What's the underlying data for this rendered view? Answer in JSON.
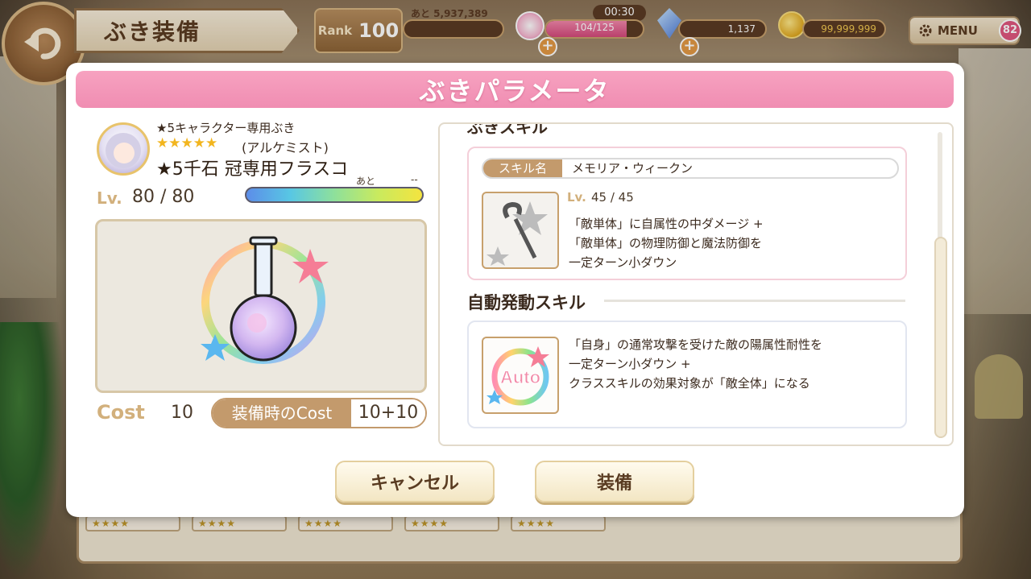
{
  "topbar": {
    "screen_title": "ぶき装備",
    "rank_label": "Rank",
    "rank_value": "100",
    "exp_text": "あと 5,937,389",
    "stamina_timer": "00:30",
    "stamina_text": "104/125",
    "stamina_fraction": 0.832,
    "gems": "1,137",
    "coins": "99,999,999",
    "menu_label": "MENU",
    "menu_badge": "82",
    "plus_symbol": "+"
  },
  "modal": {
    "title": "ぶきパラメータ",
    "weapon": {
      "type": "★5キャラクター専用ぶき",
      "stars": "★★★★★",
      "class": "(アルケミスト)",
      "name": "★5千石 冠専用フラスコ",
      "lv_label": "Lv.",
      "lv_value": "80 / 80",
      "lv_remaining_label": "あと",
      "lv_remaining_value": "--",
      "cost_label": "Cost",
      "cost_value": "10",
      "equip_cost_label": "装備時のCost",
      "equip_cost_value": "10+10"
    },
    "skill": {
      "section_title_cut": "ぶきスキル",
      "name_label": "スキル名",
      "name_value": "メモリア・ウィークン",
      "lv_label": "Lv.",
      "lv_value": "45 / 45",
      "desc_lines": [
        "「敵単体」に自属性の中ダメージ +",
        "「敵単体」の物理防御と魔法防御を",
        "一定ターン小ダウン"
      ]
    },
    "auto_skill": {
      "title": "自動発動スキル",
      "icon_text": "Auto",
      "desc_lines": [
        "「自身」の通常攻撃を受けた敵の陽属性耐性を",
        "一定ターン小ダウン +",
        "クラススキルの効果対象が「敵全体」になる"
      ]
    },
    "buttons": {
      "cancel": "キャンセル",
      "equip": "装備"
    }
  },
  "background_slots": [
    "★★★★",
    "★★★★",
    "★★★★",
    "★★★★",
    "★★★★"
  ],
  "colors": {
    "header_pink": "#f08db2",
    "accent_tan": "#c39a6c",
    "star_gold": "#f2b51e"
  }
}
